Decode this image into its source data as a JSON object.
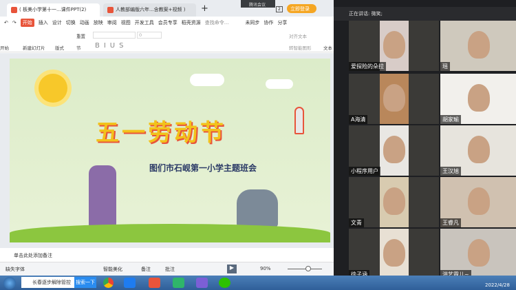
{
  "tabs": [
    {
      "label": "( 板美小学第十一...课件PPT(2)"
    },
    {
      "label": "人教部编版六年...含教案+视频 )"
    }
  ],
  "new_tab": "+",
  "meeting_badge": "腾讯会议",
  "login_button": "立即登录",
  "page_indicator": "2",
  "menu": [
    "开始",
    "插入",
    "设计",
    "切换",
    "动画",
    "放映",
    "审阅",
    "视图",
    "开发工具",
    "会员专享",
    "稻壳资源"
  ],
  "search_placeholder": "查找命令...",
  "sync": "未同步",
  "collab": "协作",
  "share": "分享",
  "ribbon": {
    "start": "开始",
    "new_slide": "新建幻灯片",
    "layout": "版式",
    "section": "节",
    "reset": "重置",
    "font_size": "0",
    "align_text": "对齐文本",
    "smartart": "转智能图形",
    "textbox": "文本"
  },
  "slide": {
    "title": "五一劳动节",
    "subtitle": "图们市石岘第一小学主题班会"
  },
  "notes_placeholder": "单击此处添加备注",
  "status": {
    "missing_font": "缺失字体",
    "beautify": "智能美化",
    "notes": "备注",
    "comments": "批注",
    "zoom": "90%"
  },
  "taskbar": {
    "search_text": "长春逐步解除管控",
    "search_button": "搜索一下",
    "date": "2022/4/28"
  },
  "meeting": {
    "speaking": "正在讲话: 微笑;",
    "participants": [
      "爱探险的朵拉",
      "瑶",
      "A海清",
      "胡家瑜",
      "小程序用户",
      "王汉旭",
      "文青",
      "王睿凡",
      "徐子涵",
      "洪艺霖儿~"
    ]
  }
}
